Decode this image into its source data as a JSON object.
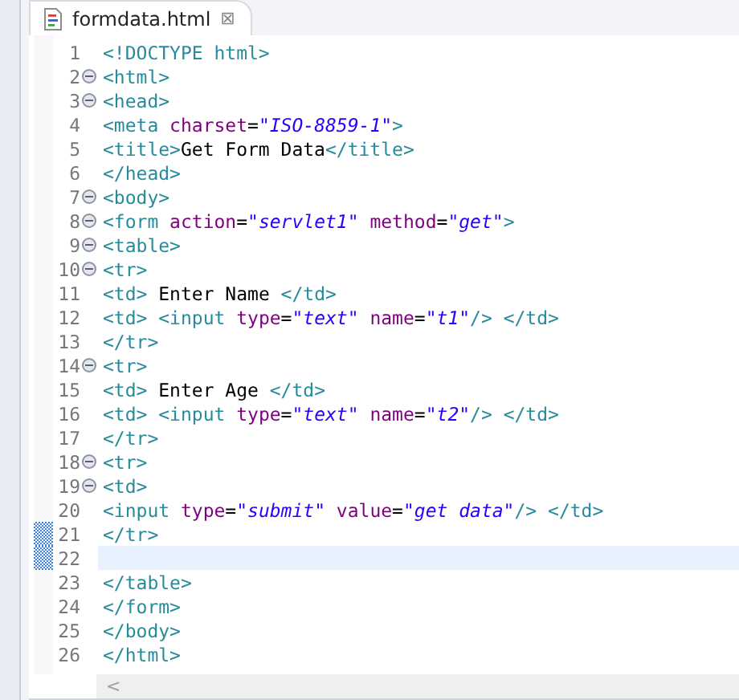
{
  "tab": {
    "title": "formdata.html",
    "selected": true,
    "close": "⊠"
  },
  "lines": [
    {
      "number": "1",
      "foldable": false,
      "current": false,
      "changed": false,
      "tokens": [
        {
          "kind": "tag",
          "text": "<!DOCTYPE html>"
        }
      ]
    },
    {
      "number": "2",
      "foldable": true,
      "current": false,
      "changed": false,
      "tokens": [
        {
          "kind": "tag",
          "text": "<html>"
        }
      ]
    },
    {
      "number": "3",
      "foldable": true,
      "current": false,
      "changed": false,
      "tokens": [
        {
          "kind": "tag",
          "text": "<head>"
        }
      ]
    },
    {
      "number": "4",
      "foldable": false,
      "current": false,
      "changed": false,
      "tokens": [
        {
          "kind": "tag",
          "text": "<meta"
        },
        {
          "kind": "attr",
          "text": " charset"
        },
        {
          "kind": "text",
          "text": "="
        },
        {
          "kind": "value",
          "text": "\"ISO-8859-1\""
        },
        {
          "kind": "tag",
          "text": ">"
        }
      ]
    },
    {
      "number": "5",
      "foldable": false,
      "current": false,
      "changed": false,
      "tokens": [
        {
          "kind": "tag",
          "text": "<title>"
        },
        {
          "kind": "text",
          "text": "Get Form Data"
        },
        {
          "kind": "tag",
          "text": "</title>"
        }
      ]
    },
    {
      "number": "6",
      "foldable": false,
      "current": false,
      "changed": false,
      "tokens": [
        {
          "kind": "tag",
          "text": "</head>"
        }
      ]
    },
    {
      "number": "7",
      "foldable": true,
      "current": false,
      "changed": false,
      "tokens": [
        {
          "kind": "tag",
          "text": "<body>"
        }
      ]
    },
    {
      "number": "8",
      "foldable": true,
      "current": false,
      "changed": false,
      "tokens": [
        {
          "kind": "tag",
          "text": "<form"
        },
        {
          "kind": "attr",
          "text": " action"
        },
        {
          "kind": "text",
          "text": "="
        },
        {
          "kind": "value",
          "text": "\"servlet1\""
        },
        {
          "kind": "attr",
          "text": " method"
        },
        {
          "kind": "text",
          "text": "="
        },
        {
          "kind": "value",
          "text": "\"get\""
        },
        {
          "kind": "tag",
          "text": ">"
        }
      ]
    },
    {
      "number": "9",
      "foldable": true,
      "current": false,
      "changed": false,
      "tokens": [
        {
          "kind": "tag",
          "text": "<table>"
        }
      ]
    },
    {
      "number": "10",
      "foldable": true,
      "current": false,
      "changed": false,
      "tokens": [
        {
          "kind": "tag",
          "text": "<tr>"
        }
      ]
    },
    {
      "number": "11",
      "foldable": false,
      "current": false,
      "changed": false,
      "tokens": [
        {
          "kind": "tag",
          "text": "<td>"
        },
        {
          "kind": "text",
          "text": " Enter Name "
        },
        {
          "kind": "tag",
          "text": "</td>"
        }
      ]
    },
    {
      "number": "12",
      "foldable": false,
      "current": false,
      "changed": false,
      "tokens": [
        {
          "kind": "tag",
          "text": "<td>"
        },
        {
          "kind": "tag",
          "text": " <input"
        },
        {
          "kind": "attr",
          "text": " type"
        },
        {
          "kind": "text",
          "text": "="
        },
        {
          "kind": "value",
          "text": "\"text\""
        },
        {
          "kind": "attr",
          "text": " name"
        },
        {
          "kind": "text",
          "text": "="
        },
        {
          "kind": "value",
          "text": "\"t1\""
        },
        {
          "kind": "tag",
          "text": "/>"
        },
        {
          "kind": "tag",
          "text": " </td>"
        }
      ]
    },
    {
      "number": "13",
      "foldable": false,
      "current": false,
      "changed": false,
      "tokens": [
        {
          "kind": "tag",
          "text": "</tr>"
        }
      ]
    },
    {
      "number": "14",
      "foldable": true,
      "current": false,
      "changed": false,
      "tokens": [
        {
          "kind": "tag",
          "text": "<tr>"
        }
      ]
    },
    {
      "number": "15",
      "foldable": false,
      "current": false,
      "changed": false,
      "tokens": [
        {
          "kind": "tag",
          "text": "<td>"
        },
        {
          "kind": "text",
          "text": " Enter Age "
        },
        {
          "kind": "tag",
          "text": "</td>"
        }
      ]
    },
    {
      "number": "16",
      "foldable": false,
      "current": false,
      "changed": false,
      "tokens": [
        {
          "kind": "tag",
          "text": "<td>"
        },
        {
          "kind": "tag",
          "text": " <input"
        },
        {
          "kind": "attr",
          "text": " type"
        },
        {
          "kind": "text",
          "text": "="
        },
        {
          "kind": "value",
          "text": "\"text\""
        },
        {
          "kind": "attr",
          "text": " name"
        },
        {
          "kind": "text",
          "text": "="
        },
        {
          "kind": "value",
          "text": "\"t2\""
        },
        {
          "kind": "tag",
          "text": "/>"
        },
        {
          "kind": "tag",
          "text": " </td>"
        }
      ]
    },
    {
      "number": "17",
      "foldable": false,
      "current": false,
      "changed": false,
      "tokens": [
        {
          "kind": "tag",
          "text": "</tr>"
        }
      ]
    },
    {
      "number": "18",
      "foldable": true,
      "current": false,
      "changed": false,
      "tokens": [
        {
          "kind": "tag",
          "text": "<tr>"
        }
      ]
    },
    {
      "number": "19",
      "foldable": true,
      "current": false,
      "changed": false,
      "tokens": [
        {
          "kind": "tag",
          "text": "<td>"
        }
      ]
    },
    {
      "number": "20",
      "foldable": false,
      "current": false,
      "changed": false,
      "tokens": [
        {
          "kind": "tag",
          "text": "<input"
        },
        {
          "kind": "attr",
          "text": " type"
        },
        {
          "kind": "text",
          "text": "="
        },
        {
          "kind": "value",
          "text": "\"submit\""
        },
        {
          "kind": "attr",
          "text": " value"
        },
        {
          "kind": "text",
          "text": "="
        },
        {
          "kind": "value",
          "text": "\"get data\""
        },
        {
          "kind": "tag",
          "text": "/>"
        },
        {
          "kind": "tag",
          "text": " </td>"
        }
      ]
    },
    {
      "number": "21",
      "foldable": false,
      "current": false,
      "changed": true,
      "tokens": [
        {
          "kind": "tag",
          "text": "</tr>"
        }
      ]
    },
    {
      "number": "22",
      "foldable": false,
      "current": true,
      "changed": true
    },
    {
      "number": "23",
      "foldable": false,
      "current": false,
      "changed": false,
      "tokens": [
        {
          "kind": "tag",
          "text": "</table>"
        }
      ]
    },
    {
      "number": "24",
      "foldable": false,
      "current": false,
      "changed": false,
      "tokens": [
        {
          "kind": "tag",
          "text": "</form>"
        }
      ]
    },
    {
      "number": "25",
      "foldable": false,
      "current": false,
      "changed": false,
      "tokens": [
        {
          "kind": "tag",
          "text": "</body>"
        }
      ]
    },
    {
      "number": "26",
      "foldable": false,
      "current": false,
      "changed": false,
      "tokens": [
        {
          "kind": "tag",
          "text": "</html>"
        }
      ]
    }
  ],
  "scrollbar": {
    "arrow": "<"
  }
}
